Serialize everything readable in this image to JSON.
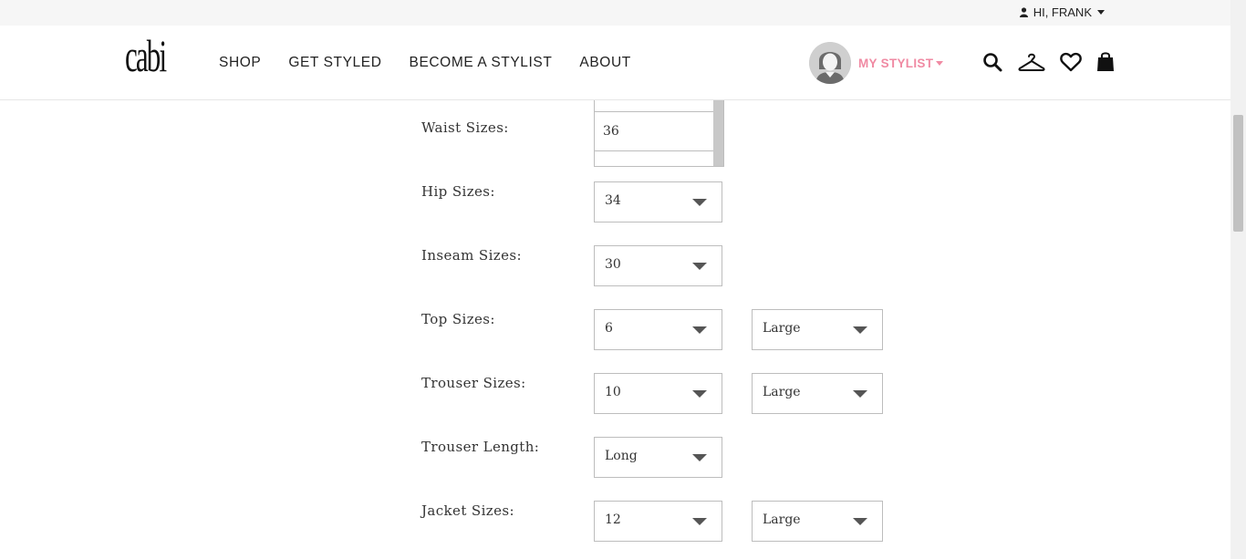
{
  "topbar": {
    "greeting": "HI, FRANK"
  },
  "header": {
    "logo": "cabi",
    "nav": [
      "SHOP",
      "GET STYLED",
      "BECOME A STYLIST",
      "ABOUT"
    ],
    "stylist_label": "MY STYLIST",
    "icons": [
      "search-icon",
      "hanger-icon",
      "heart-icon",
      "bag-icon"
    ],
    "accent_color": "#f08aa3"
  },
  "form": {
    "waist": {
      "label": "Waist Sizes:",
      "value": "36"
    },
    "hip": {
      "label": "Hip Sizes:",
      "value": "34"
    },
    "inseam": {
      "label": "Inseam Sizes:",
      "value": "30"
    },
    "top": {
      "label": "Top Sizes:",
      "value": "6",
      "fit": "Large"
    },
    "trouser": {
      "label": "Trouser Sizes:",
      "value": "10",
      "fit": "Large"
    },
    "trouser_length": {
      "label": "Trouser Length:",
      "value": "Long"
    },
    "jacket": {
      "label": "Jacket Sizes:",
      "value": "12",
      "fit": "Large"
    }
  }
}
